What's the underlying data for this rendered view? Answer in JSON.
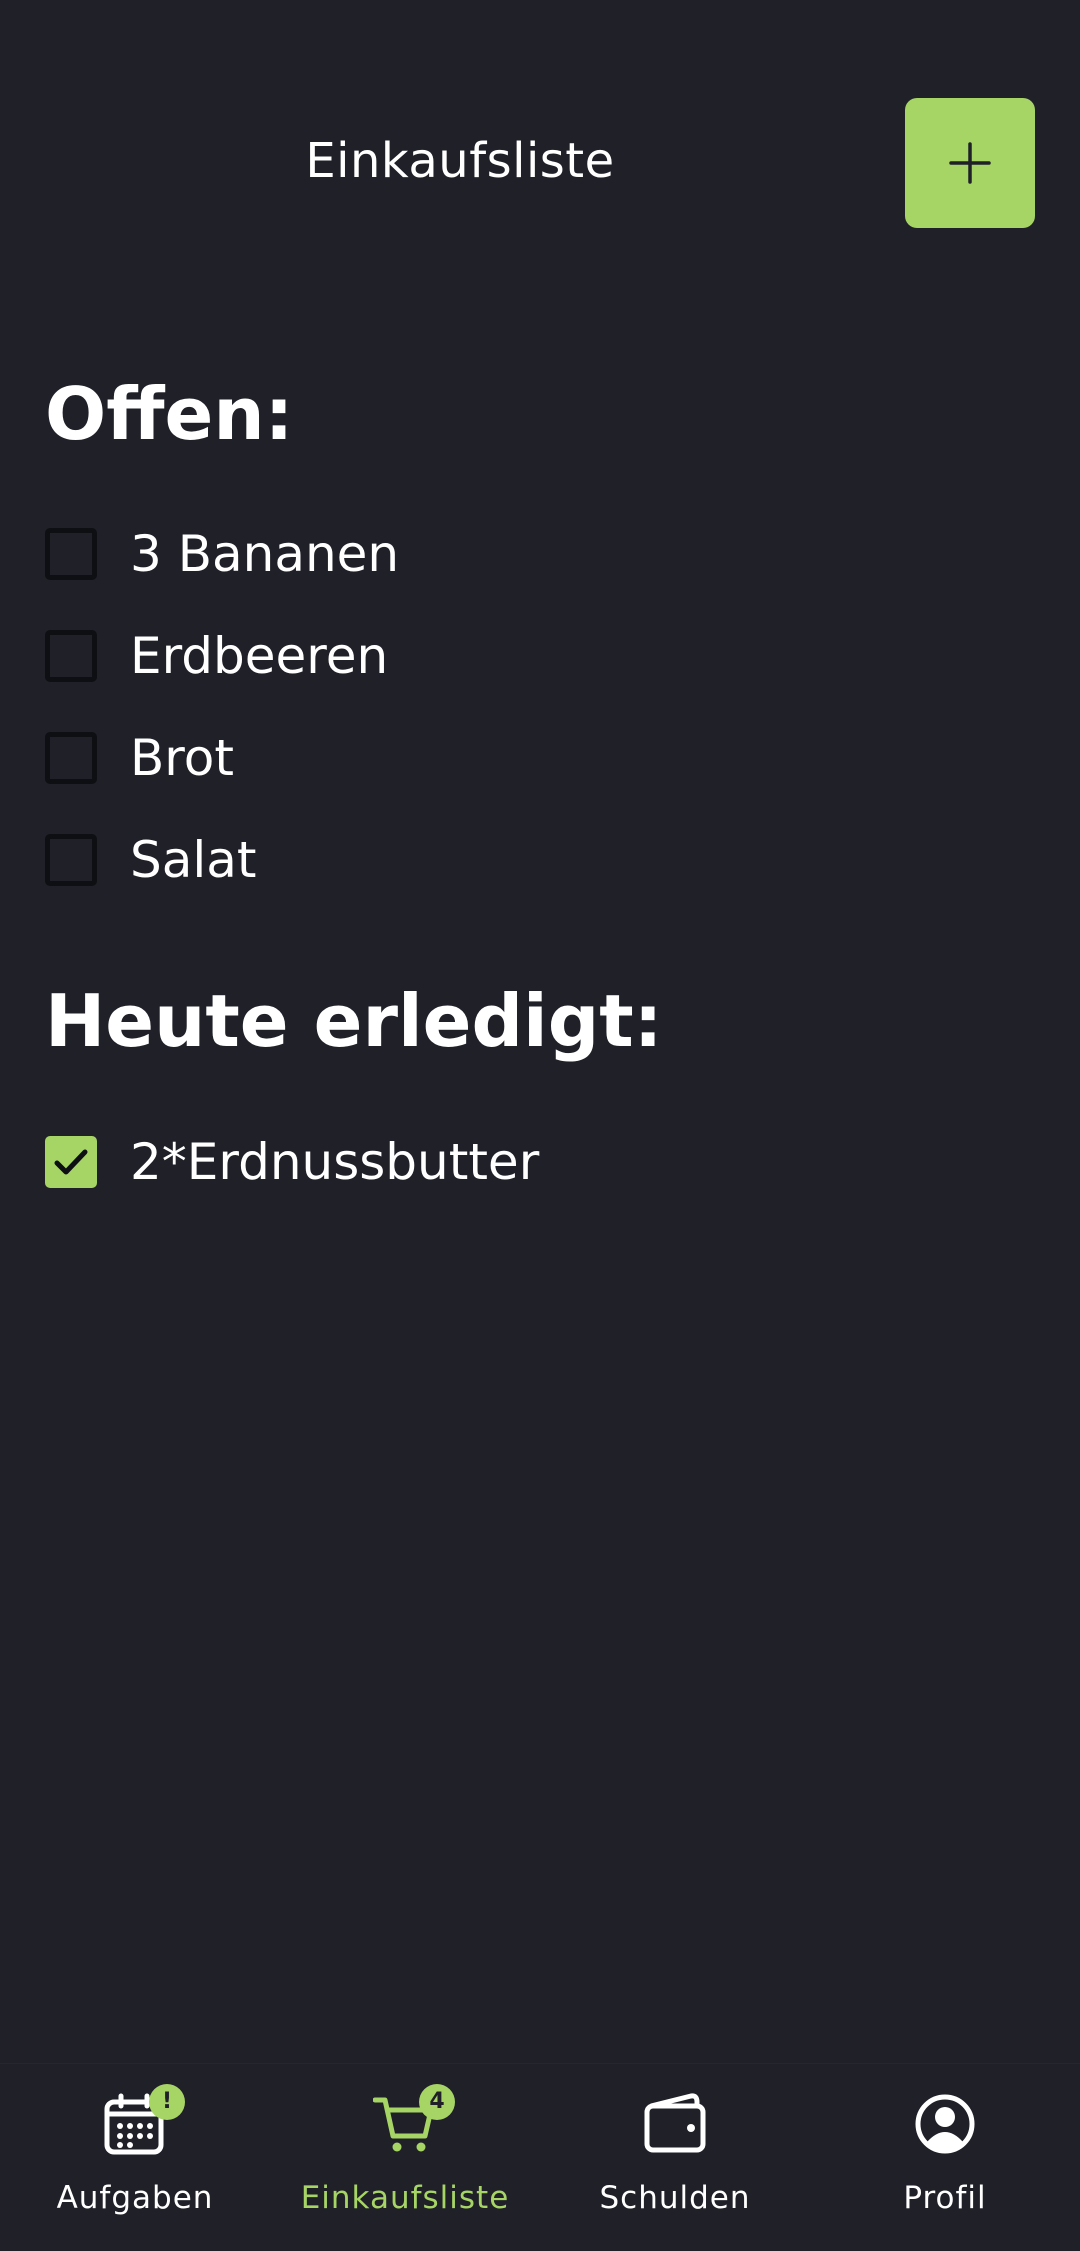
{
  "header": {
    "title": "Einkaufsliste",
    "add_icon": "plus-icon"
  },
  "sections": {
    "open": {
      "title": "Offen:",
      "items": [
        {
          "label": "3 Bananen",
          "checked": false
        },
        {
          "label": "Erdbeeren",
          "checked": false
        },
        {
          "label": "Brot",
          "checked": false
        },
        {
          "label": "Salat",
          "checked": false
        }
      ]
    },
    "done": {
      "title": "Heute erledigt:",
      "items": [
        {
          "label": "2*Erdnussbutter",
          "checked": true
        }
      ]
    }
  },
  "nav": {
    "items": [
      {
        "label": "Aufgaben",
        "icon": "calendar-icon",
        "badge": "!",
        "active": false
      },
      {
        "label": "Einkaufsliste",
        "icon": "cart-icon",
        "badge": "4",
        "active": true
      },
      {
        "label": "Schulden",
        "icon": "wallet-icon",
        "badge": "",
        "active": false
      },
      {
        "label": "Profil",
        "icon": "user-icon",
        "badge": "",
        "active": false
      }
    ]
  },
  "colors": {
    "background": "#1f2028",
    "accent": "#a6d465",
    "text": "#ffffff",
    "checkbox_border": "#0e0f13"
  }
}
